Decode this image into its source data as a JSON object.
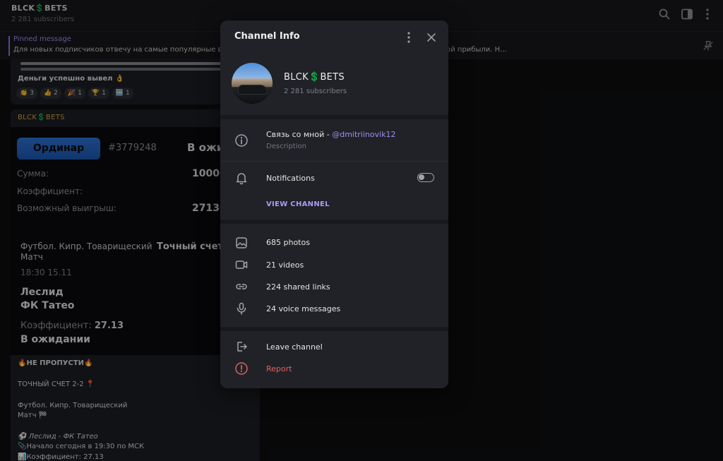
{
  "channel": {
    "title": "BLCK💲BETS",
    "subscribers": "2 281 subscribers"
  },
  "pinned": {
    "label": "Pinned message",
    "text": "Для новых подписчиков отвечу на самые популярные вопросы ... но, после выигрыша вы оплачиваете 40% от чистой прибыли.  Н..."
  },
  "messages": {
    "first": {
      "text": "Деньги успешно вывел 👌",
      "reactions": [
        {
          "emoji": "👏",
          "count": "3"
        },
        {
          "emoji": "👍",
          "count": "2"
        },
        {
          "emoji": "🎉",
          "count": "1"
        },
        {
          "emoji": "🏆",
          "count": "1"
        },
        {
          "emoji": "🆒",
          "count": "1"
        }
      ]
    },
    "second": {
      "sender": "BLCK💲BETS",
      "bet": {
        "type_button": "Ординар",
        "id": "#3779248",
        "status": "В ожид",
        "amount_label": "Сумма:",
        "amount_value": "10000",
        "coef_label": "Коэффициент:",
        "win_label": "Возможный выигрыш:",
        "win_value": "27130",
        "match_name": "Футбол. Кипр. Товарищеский Матч",
        "match_type": "Точный счет",
        "match_time": "18:30 15.11",
        "teams_line1": "Леслид",
        "teams_line2": "ФК Татео",
        "coef2_label": "Коэффициент:",
        "coef2_value": "27.13",
        "waiting": "В ожидании"
      },
      "caption": {
        "line1": "🔥НЕ ПРОПУСТИ🔥",
        "line2": "ТОЧНЫЙ СЧЕТ 2-2 📍",
        "line3": "Футбол. Кипр. Товарищеский",
        "line4": "Матч 🏁",
        "line5": "⚽ Леслид - ФК Татео",
        "line6": "📎Начало сегодня в 19:30 по МСК",
        "line7": "📊Коэффициент: 27.13"
      }
    }
  },
  "modal": {
    "title": "Channel Info",
    "info_name": "BLCK💲BETS",
    "info_subscribers": "2 281 subscribers",
    "description_prefix": "Связь со мной - ",
    "description_link": "@dmitriinovik12",
    "description_label": "Description",
    "notifications_label": "Notifications",
    "notifications_enabled": false,
    "view_channel": "VIEW CHANNEL",
    "media": {
      "photos": "685 photos",
      "videos": "21 videos",
      "links": "224 shared links",
      "voice": "24 voice messages"
    },
    "leave": "Leave channel",
    "report": "Report"
  },
  "icons": [
    "search-icon",
    "sidebar-toggle-icon",
    "more-vertical-icon",
    "pin-off-icon",
    "close-icon",
    "info-icon",
    "bell-icon",
    "photo-icon",
    "video-icon",
    "link-icon",
    "microphone-icon",
    "logout-icon",
    "report-icon"
  ],
  "colors": {
    "accent": "#8774e1",
    "danger": "#e0615f",
    "modal_bg": "#212227",
    "sender": "#d4a53c"
  }
}
